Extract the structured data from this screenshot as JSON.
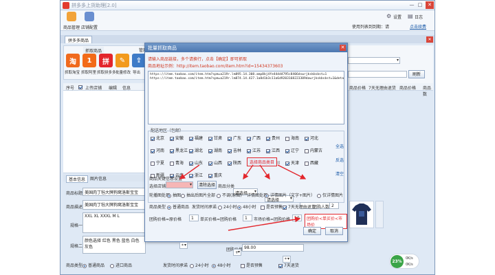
{
  "app": {
    "window_title": "拼多多上货助理[2.0]",
    "toolbar": {
      "goods_mgmt": "商品管理",
      "shop_edit": "店铺配置"
    },
    "top_right": {
      "settings": "设置",
      "log": "日志",
      "user_text": "使用列表到到期：请",
      "renew": "点击续费"
    },
    "tab": "拼多多商品"
  },
  "left_panel": {
    "section_title": "抓取商品",
    "icons": [
      {
        "glyph": "淘",
        "label": "抓取淘宝"
      },
      {
        "glyph": "1",
        "label": "抓取阿里"
      },
      {
        "glyph": "拼",
        "label": "抓取拼多多"
      },
      {
        "glyph": "✎",
        "label": "批量修改"
      },
      {
        "glyph": "⇪",
        "label": "导出"
      }
    ],
    "manage_label": "管理",
    "grid": {
      "col1": "序号",
      "col2": "上传店铺",
      "col3": "编辑",
      "col4": "信息"
    }
  },
  "right_columns": {
    "refresh_btn": "刷新",
    "headers": [
      "商品价格",
      "7天无理由退货",
      "商品价格",
      "商品数"
    ]
  },
  "bottom": {
    "tabs": [
      "基本信息",
      "图片信息"
    ],
    "title_label": "商品标题",
    "title_val": "美国肉丁毡大牌狗窝洛斯宝宝",
    "title_val2": "商品规格",
    "desc_label": "商品描述",
    "desc_val": "美国肉丁毡大牌狗窝洛斯宝宝",
    "spec1_label": "规格一",
    "spec1_val": "XXL XL XXXL M L",
    "spec2_label": "规格二",
    "spec2_val": "颜色选择 红色 黑色 蓝色 白色 灰色",
    "group_price_label": "团购价格",
    "group_price_val": "98.00",
    "goods_type_label": "商品类型",
    "opt_normal": "普通商品",
    "opt_import": "进口商品",
    "ship_time_label": "发货时间承诺",
    "opt_24": "24小时",
    "opt_48": "48小时",
    "pre_sale": "是否预售",
    "seven_day": "7天退货"
  },
  "dialog": {
    "title": "批量抓取商品",
    "instr1": "请输入商品链接，多个请换行，点击【确定】即可抓取",
    "instr2": "商品地址示例：http://item.taobao.com/item.htm?id=15434373603",
    "urls": [
      "https://item.taobao.com/item.htm?spm=a219r.lm895.14.308.amp8bj4fe44dd4795c8406dswrjkskbsbst=1",
      "https://item.taobao.com/item.htm?spm=a219r.lm874.14.427.1a8d1b3c11a6d9203168223309dawrjkskbsbst=1&detail"
    ],
    "region_title": "配送地区（包邮）",
    "provinces_row1": [
      "北京",
      "安徽",
      "福建",
      "甘肃",
      "广东",
      "广西",
      "贵州",
      "海南",
      "河北"
    ],
    "provinces_row2": [
      "河南",
      "黑龙江",
      "湖北",
      "湖南",
      "吉林",
      "江苏",
      "江西",
      "辽宁",
      "内蒙古"
    ],
    "provinces_row3": [
      "宁夏",
      "青海",
      "山东",
      "山西",
      "陕西",
      "上海",
      "四川",
      "天津",
      "西藏"
    ],
    "provinces_row4": [
      "新疆",
      "云南",
      "浙江",
      "重庆"
    ],
    "row2_checked": [
      "河南",
      "黑龙江",
      "湖北",
      "湖南",
      "吉林",
      "江苏",
      "江西",
      "辽宁"
    ],
    "row3_checked": [
      "山东",
      "山西",
      "陕西",
      "上海",
      "四川",
      "天津"
    ],
    "row4_checked": [
      "新疆",
      "云南",
      "浙江",
      "重庆"
    ],
    "links": [
      "全选",
      "反选",
      "清空"
    ],
    "settings_title": "商品关键信息设置",
    "shop_label": "选择店铺",
    "shop_btn": "清除选择",
    "cat_label": "商品分类",
    "cat_ph1": "请选择",
    "cat_ph2": "请选择",
    "image_label": "轮播图处理",
    "img_opt1": "抽图",
    "img_opt2": "抽出后图片全部",
    "img_opt3": "不调(原图)",
    "detail_label": "详情图处理",
    "det_opt1": "详情图片（文字+图片）",
    "det_opt2": "仅详情图片",
    "type_label": "商品类型",
    "type_opt1": "普通商品",
    "ship_label": "发货时间承诺",
    "ship_opt1": "24小时",
    "ship_opt2": "48小时",
    "presale": "是否预售",
    "seven": "7天无理由退货",
    "group_label": "团购人数",
    "group_val": "2",
    "price_label1": "团购价格=原价格",
    "price_op1": "*",
    "price_val1": "1",
    "price_label2": "单买价格=团购价格",
    "price_op2": "+",
    "price_val2": "1",
    "market_label": "市场价格=团购价格",
    "market_op": "*",
    "market_val": "10",
    "note": "团购价<单买价<市场价",
    "annotation": "选择商品类目",
    "ok": "确定",
    "cancel": "取消"
  },
  "status": {
    "percent": "23%",
    "up": "0K/s",
    "down": "0K/s"
  },
  "colors": {
    "accent": "#e3262c",
    "titlebar": "#4c77b0"
  }
}
